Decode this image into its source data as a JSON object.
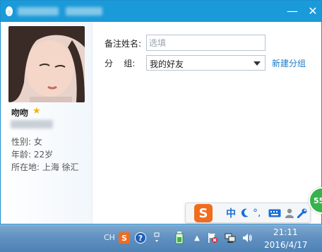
{
  "window": {
    "min_glyph": "—",
    "close_glyph": "✕"
  },
  "profile": {
    "nickname": "吻吻",
    "gender": "性别: 女",
    "age": "年龄: 22岁",
    "location": "所在地: 上海  徐汇"
  },
  "form": {
    "remark_label": "备注姓名:",
    "remark_placeholder": "选填",
    "group_label": "分    组:",
    "group_value": "我的好友",
    "new_group_link": "新建分组"
  },
  "ime": {
    "logo": "S",
    "lang": "中",
    "punct": "°,",
    "icons": [
      "sogou-logo-icon",
      "moon-icon",
      "punctuation-icon",
      "keyboard-icon",
      "user-icon",
      "wrench-icon"
    ]
  },
  "badge": {
    "value": "55"
  },
  "taskbar": {
    "lang_indicator": "CH",
    "sogou_glyph": "S",
    "help_glyph": "?",
    "expand_glyph": "▲",
    "time": "21:11",
    "date": "2016/4/17"
  },
  "colors": {
    "titlebar": "#1a9ad8",
    "link": "#1a7bc9",
    "sogou": "#f06c1f",
    "badge": "#36b34a"
  }
}
